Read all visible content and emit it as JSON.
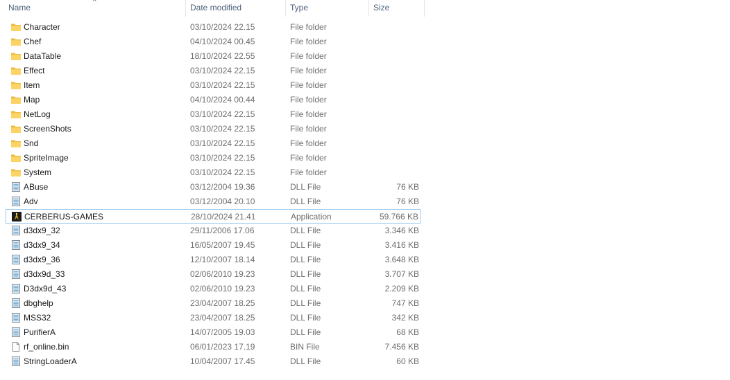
{
  "columns": {
    "name": "Name",
    "date": "Date modified",
    "type": "Type",
    "size": "Size"
  },
  "files": [
    {
      "name": "Character",
      "date": "03/10/2024 22.15",
      "type": "File folder",
      "size": "",
      "icon": "folder-icon"
    },
    {
      "name": "Chef",
      "date": "04/10/2024 00.45",
      "type": "File folder",
      "size": "",
      "icon": "folder-icon"
    },
    {
      "name": "DataTable",
      "date": "18/10/2024 22.55",
      "type": "File folder",
      "size": "",
      "icon": "folder-icon"
    },
    {
      "name": "Effect",
      "date": "03/10/2024 22.15",
      "type": "File folder",
      "size": "",
      "icon": "folder-icon"
    },
    {
      "name": "Item",
      "date": "03/10/2024 22.15",
      "type": "File folder",
      "size": "",
      "icon": "folder-icon"
    },
    {
      "name": "Map",
      "date": "04/10/2024 00.44",
      "type": "File folder",
      "size": "",
      "icon": "folder-icon"
    },
    {
      "name": "NetLog",
      "date": "03/10/2024 22.15",
      "type": "File folder",
      "size": "",
      "icon": "folder-icon"
    },
    {
      "name": "ScreenShots",
      "date": "03/10/2024 22.15",
      "type": "File folder",
      "size": "",
      "icon": "folder-icon"
    },
    {
      "name": "Snd",
      "date": "03/10/2024 22.15",
      "type": "File folder",
      "size": "",
      "icon": "folder-icon"
    },
    {
      "name": "SpriteImage",
      "date": "03/10/2024 22.15",
      "type": "File folder",
      "size": "",
      "icon": "folder-icon"
    },
    {
      "name": "System",
      "date": "03/10/2024 22.15",
      "type": "File folder",
      "size": "",
      "icon": "folder-icon"
    },
    {
      "name": "ABuse",
      "date": "03/12/2004 19.36",
      "type": "DLL File",
      "size": "76 KB",
      "icon": "dll-icon"
    },
    {
      "name": "Adv",
      "date": "03/12/2004 20.10",
      "type": "DLL File",
      "size": "76 KB",
      "icon": "dll-icon"
    },
    {
      "name": "CERBERUS-GAMES",
      "date": "28/10/2024 21.41",
      "type": "Application",
      "size": "59.766 KB",
      "icon": "app-icon",
      "selected": true
    },
    {
      "name": "d3dx9_32",
      "date": "29/11/2006 17.06",
      "type": "DLL File",
      "size": "3.346 KB",
      "icon": "dll-icon"
    },
    {
      "name": "d3dx9_34",
      "date": "16/05/2007 19.45",
      "type": "DLL File",
      "size": "3.416 KB",
      "icon": "dll-icon"
    },
    {
      "name": "d3dx9_36",
      "date": "12/10/2007 18.14",
      "type": "DLL File",
      "size": "3.648 KB",
      "icon": "dll-icon"
    },
    {
      "name": "d3dx9d_33",
      "date": "02/06/2010 19.23",
      "type": "DLL File",
      "size": "3.707 KB",
      "icon": "dll-icon"
    },
    {
      "name": "D3dx9d_43",
      "date": "02/06/2010 19.23",
      "type": "DLL File",
      "size": "2.209 KB",
      "icon": "dll-icon"
    },
    {
      "name": "dbghelp",
      "date": "23/04/2007 18.25",
      "type": "DLL File",
      "size": "747 KB",
      "icon": "dll-icon"
    },
    {
      "name": "MSS32",
      "date": "23/04/2007 18.25",
      "type": "DLL File",
      "size": "342 KB",
      "icon": "dll-icon"
    },
    {
      "name": "PurifierA",
      "date": "14/07/2005 19.03",
      "type": "DLL File",
      "size": "68 KB",
      "icon": "dll-icon"
    },
    {
      "name": "rf_online.bin",
      "date": "06/01/2023 17.19",
      "type": "BIN File",
      "size": "7.456 KB",
      "icon": "file-icon"
    },
    {
      "name": "StringLoaderA",
      "date": "10/04/2007 17.45",
      "type": "DLL File",
      "size": "60 KB",
      "icon": "dll-icon"
    }
  ]
}
